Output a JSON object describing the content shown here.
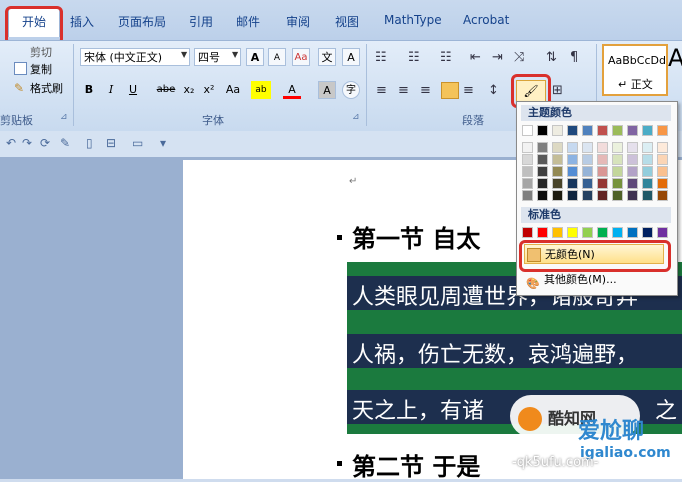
{
  "tabs": [
    {
      "label": "开始"
    },
    {
      "label": "插入"
    },
    {
      "label": "页面布局"
    },
    {
      "label": "引用"
    },
    {
      "label": "邮件"
    },
    {
      "label": "审阅"
    },
    {
      "label": "视图"
    },
    {
      "label": "MathType"
    },
    {
      "label": "Acrobat"
    }
  ],
  "clipboard": {
    "cut": "剪切",
    "copy": "复制",
    "format_painter": "格式刷",
    "label": "剪贴板"
  },
  "font": {
    "name": "宋体 (中文正文)",
    "size": "四号",
    "label": "字体",
    "grow": "A",
    "shrink": "A",
    "clear": "Aa",
    "phonetic": "文",
    "border": "A",
    "bold": "B",
    "italic": "I",
    "underline": "U",
    "strike": "abe",
    "subscript": "x₂",
    "superscript": "x²",
    "case": "Aa",
    "highlight": "ab",
    "color": "A",
    "shade": "A",
    "enclose": "字"
  },
  "paragraph": {
    "label": "段落"
  },
  "styles": {
    "sample": "AaBbCcDd",
    "name": "↵ 正文",
    "next_sample": "A"
  },
  "dropdown": {
    "theme_header": "主题颜色",
    "standard_header": "标准色",
    "no_color": "无颜色(N)",
    "more_colors": "其他颜色(M)...",
    "theme_top": [
      "#ffffff",
      "#000000",
      "#eeece1",
      "#1f497d",
      "#4f81bd",
      "#c0504d",
      "#9bbb59",
      "#8064a2",
      "#4bacc6",
      "#f79646"
    ],
    "theme_tints": [
      [
        "#f2f2f2",
        "#7f7f7f",
        "#ddd9c3",
        "#c6d9f0",
        "#dbe5f1",
        "#f2dcdb",
        "#ebf1dd",
        "#e5e0ec",
        "#dbeef3",
        "#fdeada"
      ],
      [
        "#d8d8d8",
        "#595959",
        "#c4bd97",
        "#8db3e2",
        "#b8cce4",
        "#e5b9b7",
        "#d7e3bc",
        "#ccc1d9",
        "#b7dde8",
        "#fbd5b5"
      ],
      [
        "#bfbfbf",
        "#3f3f3f",
        "#938953",
        "#548dd4",
        "#95b3d7",
        "#d99694",
        "#c3d69b",
        "#b2a2c7",
        "#92cddc",
        "#fac08f"
      ],
      [
        "#a5a5a5",
        "#262626",
        "#494429",
        "#17365d",
        "#366092",
        "#953734",
        "#76923c",
        "#5f497a",
        "#31859b",
        "#e36c09"
      ],
      [
        "#7f7f7f",
        "#0c0c0c",
        "#1d1b10",
        "#0f243e",
        "#244061",
        "#632423",
        "#4f6128",
        "#3f3151",
        "#205867",
        "#974806"
      ]
    ],
    "standard": [
      "#c00000",
      "#ff0000",
      "#ffc000",
      "#ffff00",
      "#92d050",
      "#00b050",
      "#00b0f0",
      "#0070c0",
      "#002060",
      "#7030a0"
    ]
  },
  "document": {
    "paragraph_mark": "↵",
    "heading1": "第一节  自太",
    "line1": "人类眼见周遭世界，诸般奇异",
    "line2": "人祸，伤亡无数，哀鸿遍野，",
    "line3": "天之上，有诸",
    "line3_tail": "之",
    "heading2": "第二节  于是"
  },
  "watermark": {
    "brand": "爱尬聊",
    "site": "igaliao.com",
    "sub": "-qk5ufu.com-",
    "logo_text": "酷知网"
  },
  "colors": {
    "accent_red": "#d9302c",
    "doc_green": "#1b7a3e",
    "doc_navy": "#1d2f4e"
  }
}
